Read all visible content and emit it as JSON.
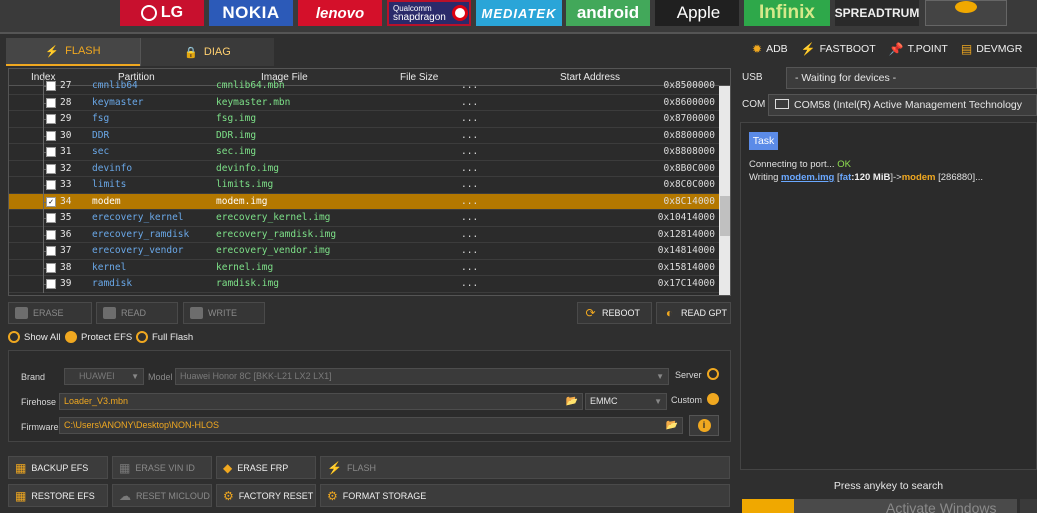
{
  "brands": [
    "LG",
    "NOKIA",
    "lenovo",
    "Qualcomm",
    "snapdragon",
    "MEDIATEK",
    "android",
    "Apple",
    "Infinix",
    "SPREADTRUM"
  ],
  "tabs": {
    "flash": "FLASH",
    "diag": "DIAG"
  },
  "table": {
    "headers": {
      "index": "Index",
      "partition": "Partition",
      "image": "Image File",
      "size": "File Size",
      "address": "Start Address"
    },
    "rows": [
      {
        "index": "27",
        "partition": "cmnlib64",
        "image": "cmnlib64.mbn",
        "size": "...",
        "address": "0x8500000"
      },
      {
        "index": "28",
        "partition": "keymaster",
        "image": "keymaster.mbn",
        "size": "...",
        "address": "0x8600000"
      },
      {
        "index": "29",
        "partition": "fsg",
        "image": "fsg.img",
        "size": "...",
        "address": "0x8700000"
      },
      {
        "index": "30",
        "partition": "DDR",
        "image": "DDR.img",
        "size": "...",
        "address": "0x8800000"
      },
      {
        "index": "31",
        "partition": "sec",
        "image": "sec.img",
        "size": "...",
        "address": "0x8808000"
      },
      {
        "index": "32",
        "partition": "devinfo",
        "image": "devinfo.img",
        "size": "...",
        "address": "0x8B0C000"
      },
      {
        "index": "33",
        "partition": "limits",
        "image": "limits.img",
        "size": "...",
        "address": "0x8C0C000"
      },
      {
        "index": "34",
        "partition": "modem",
        "image": "modem.img",
        "size": "...",
        "address": "0x8C14000",
        "checked": true,
        "selected": true
      },
      {
        "index": "35",
        "partition": "erecovery_kernel",
        "image": "erecovery_kernel.img",
        "size": "...",
        "address": "0x10414000"
      },
      {
        "index": "36",
        "partition": "erecovery_ramdisk",
        "image": "erecovery_ramdisk.img",
        "size": "...",
        "address": "0x12814000"
      },
      {
        "index": "37",
        "partition": "erecovery_vendor",
        "image": "erecovery_vendor.img",
        "size": "...",
        "address": "0x14814000"
      },
      {
        "index": "38",
        "partition": "kernel",
        "image": "kernel.img",
        "size": "...",
        "address": "0x15814000"
      },
      {
        "index": "39",
        "partition": "ramdisk",
        "image": "ramdisk.img",
        "size": "...",
        "address": "0x17C14000"
      }
    ]
  },
  "actions": {
    "erase": "ERASE",
    "read": "READ",
    "write": "WRITE",
    "reboot": "REBOOT",
    "read_gpt": "READ GPT"
  },
  "options": {
    "show_all": "Show All",
    "protect_efs": "Protect EFS",
    "full_flash": "Full Flash"
  },
  "settings": {
    "brand_label": "Brand",
    "brand_value": "HUAWEI",
    "model_label": "Model",
    "model_value": "Huawei Honor 8C [BKK-L21 LX2 LX1]",
    "server_label": "Server",
    "firehose_label": "Firehose",
    "firehose_value": "Loader_V3.mbn",
    "storage_value": "EMMC",
    "custom_label": "Custom",
    "firmware_label": "Firmware",
    "firmware_value": "C:\\Users\\ANONY\\Desktop\\NON-HLOS"
  },
  "bottom": {
    "backup_efs": "BACKUP EFS",
    "erase_vin_id": "ERASE VIN ID",
    "erase_frp": "ERASE FRP",
    "flash": "FLASH",
    "restore_efs": "RESTORE EFS",
    "reset_micloud": "RESET MICLOUD",
    "factory_reset": "FACTORY RESET",
    "format_storage": "FORMAT STORAGE"
  },
  "right": {
    "tools": [
      "ADB",
      "FASTBOOT",
      "T.POINT",
      "DEVMGR"
    ],
    "usb_label": "USB",
    "usb_value": "- Waiting for devices -",
    "com_label": "COM",
    "com_value": "COM58 (Intel(R) Active Management Technology",
    "task_label": "Task",
    "log": {
      "l1_text": "Connecting to port... ",
      "l1_status": "OK",
      "l2_prefix": "Writing ",
      "l2_file": "modem.img",
      "l2_open": " [",
      "l2_fat": "fat",
      "l2_colon": ":",
      "l2_size": "120 MiB",
      "l2_arrow": "]->",
      "l2_target": "modem",
      "l2_tail": " [286880]..."
    },
    "press_key": "Press anykey to search",
    "progress": 0.19,
    "activate": "Activate Windows"
  }
}
